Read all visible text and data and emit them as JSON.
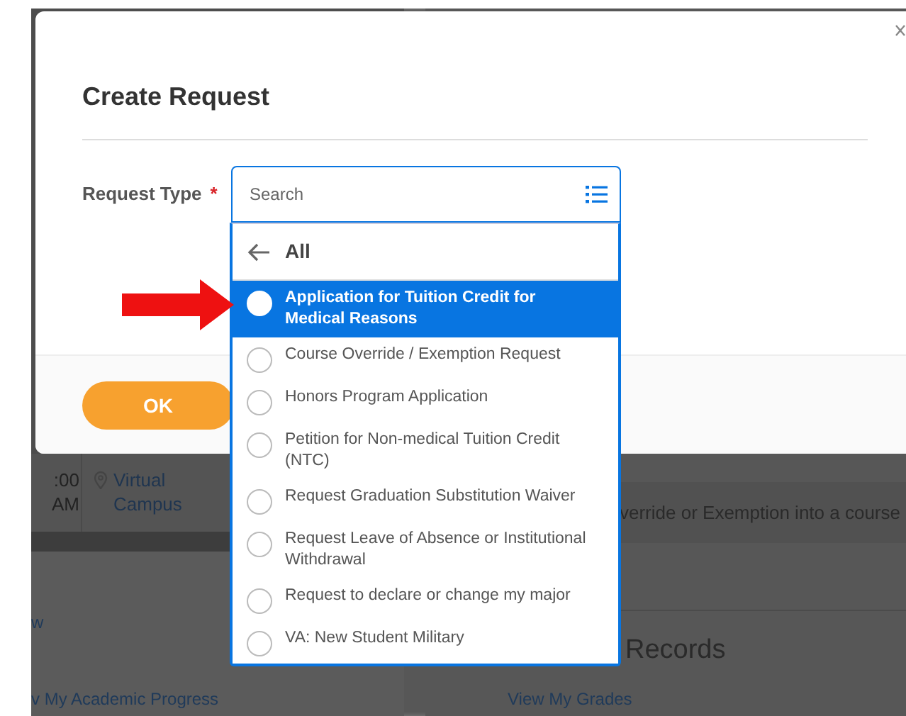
{
  "background": {
    "time_start": ":00",
    "time_end": "AM",
    "location": "Virtual Campus",
    "link_top": "w",
    "link_progress": "v My Academic Progress",
    "row_text": "verride or Exemption into a course",
    "section_title": "Records",
    "link_grades": "View My Grades"
  },
  "modal": {
    "title": "Create Request",
    "field": {
      "label": "Request Type",
      "required": true,
      "required_mark": "*",
      "placeholder": "Search"
    },
    "ok_button": "OK"
  },
  "dropdown": {
    "back_label": "All",
    "options": [
      {
        "label": "Application for Tuition Credit for Medical Reasons",
        "selected": true
      },
      {
        "label": "Course Override / Exemption Request",
        "selected": false
      },
      {
        "label": "Honors Program Application",
        "selected": false
      },
      {
        "label": "Petition for Non-medical Tuition Credit (NTC)",
        "selected": false
      },
      {
        "label": "Request Graduation Substitution Waiver",
        "selected": false
      },
      {
        "label": "Request Leave of Absence or Institutional Withdrawal",
        "selected": false
      },
      {
        "label": "Request to declare or change my major",
        "selected": false
      },
      {
        "label": "VA: New Student Military",
        "selected": false
      }
    ]
  }
}
